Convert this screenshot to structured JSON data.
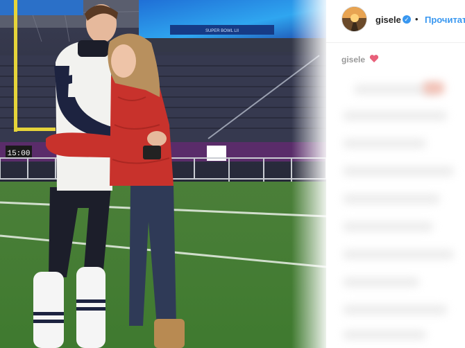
{
  "post": {
    "username": "gisele",
    "follow_label": "Прочитать",
    "separator": "•",
    "verified_icon": "verified-badge-icon",
    "caption_username": "gisele",
    "caption_emoji": "heart-emoji-icon"
  },
  "photo": {
    "scoreboard_time": "15:00",
    "banner_text": "SUPER BOWL LII"
  },
  "colors": {
    "follow_blue": "#3897f0",
    "verified_blue": "#3897f0",
    "heart_pink": "#e8607a",
    "field_green": "#4f8a3b",
    "sweater_red": "#c8322c"
  }
}
